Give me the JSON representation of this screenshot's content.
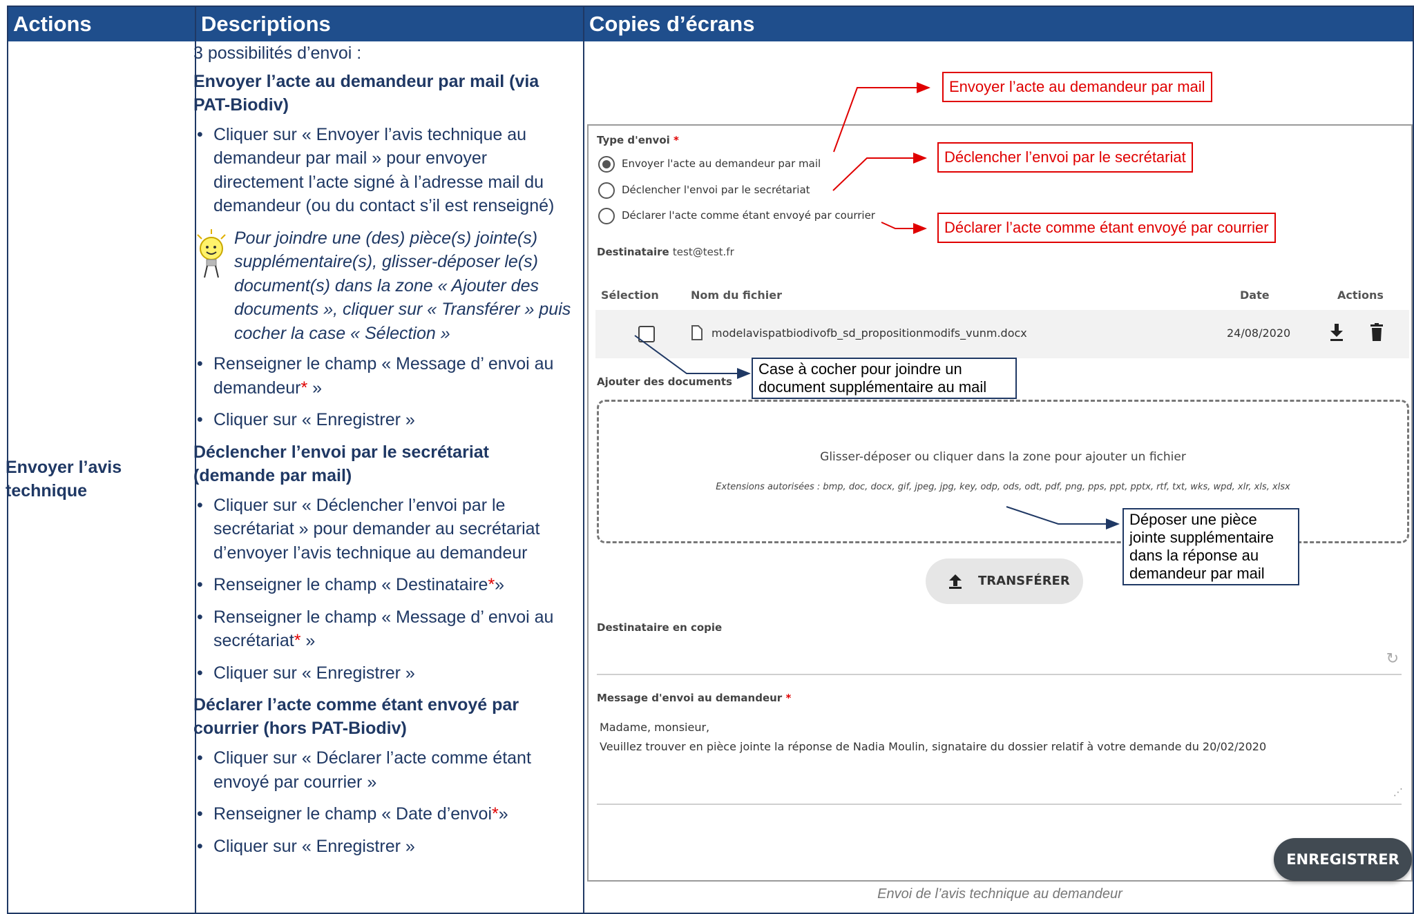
{
  "headers": {
    "actions": "Actions",
    "descriptions": "Descriptions",
    "screenshots": "Copies d’écrans"
  },
  "action_label": "Envoyer l’avis technique",
  "description": {
    "intro": "3 possibilités d’envoi :",
    "section1": {
      "title": "Envoyer l’acte au demandeur par mail (via PAT-Biodiv)",
      "item1": "Cliquer sur « Envoyer l’avis technique au demandeur par mail » pour envoyer directement l’acte signé à l’adresse mail du demandeur (ou du contact s’il est renseigné)",
      "tip": "Pour joindre une (des) pièce(s) jointe(s) supplémentaire(s), glisser-déposer le(s) document(s) dans la zone « Ajouter des documents », cliquer sur « Transférer » puis cocher la case « Sélection »",
      "item2": "Renseigner le champ « Message d’ envoi au demandeur",
      "item2_end": " »",
      "item3": "Cliquer sur « Enregistrer »"
    },
    "section2": {
      "title": "Déclencher l’envoi par le secrétariat (demande par mail)",
      "item1": "Cliquer sur « Déclencher l’envoi par le secrétariat » pour demander au secrétariat d’envoyer l’avis technique au demandeur",
      "item2": "Renseigner le champ « Destinataire",
      "item2_end": "»",
      "item3": "Renseigner le champ « Message d’ envoi au secrétariat",
      "item3_end": " »",
      "item4": "Cliquer sur « Enregistrer »"
    },
    "section3": {
      "title": "Déclarer l’acte comme étant envoyé par courrier (hors PAT-Biodiv)",
      "item1": "Cliquer sur « Déclarer l’acte comme étant envoyé par courrier »",
      "item2": "Renseigner le champ « Date d’envoi",
      "item2_end": "»",
      "item3": "Cliquer sur « Enregistrer »"
    },
    "required_mark": "*"
  },
  "screenshot": {
    "type_label": "Type d'envoi",
    "required_mark": "*",
    "options": [
      "Envoyer l'acte au demandeur par mail",
      "Déclencher l'envoi par le secrétariat",
      "Déclarer l'acte comme étant envoyé par courrier"
    ],
    "selected_option": "Envoyer l'acte au demandeur par mail",
    "recipient_label": "Destinataire",
    "recipient_value": "test@test.fr",
    "table_headers": {
      "selection": "Sélection",
      "filename": "Nom du fichier",
      "date": "Date",
      "actions": "Actions"
    },
    "file": {
      "name": "modelavispatbiodivofb_sd_propositionmodifs_vunm.docx",
      "date": "24/08/2020"
    },
    "add_docs_label": "Ajouter des documents",
    "dropzone_text": "Glisser-déposer ou cliquer dans la zone pour ajouter un fichier",
    "dropzone_ext": "Extensions autorisées : bmp, doc, docx, gif, jpeg, jpg, key, odp, ods, odt, pdf, png, pps, ppt, pptx, rtf, txt, wks, wpd, xlr, xls, xlsx",
    "transfer_label": "TRANSFÉRER",
    "cc_label": "Destinataire en copie",
    "message_label": "Message d'envoi au demandeur",
    "message_text": "Madame, monsieur,\nVeuillez trouver en pièce jointe la réponse de Nadia Moulin, signataire du dossier relatif à votre demande du 20/02/2020",
    "save_label": "ENREGISTRER"
  },
  "callouts": {
    "mail": "Envoyer l’acte au demandeur par mail",
    "secretariat": "Déclencher l’envoi par le secrétariat",
    "courrier": "Déclarer l’acte comme étant envoyé par courrier",
    "checkbox": "Case à cocher pour joindre un document supplémentaire au mail",
    "dropzone": "Déposer une pièce jointe supplémentaire dans la réponse au demandeur par mail"
  },
  "caption": "Envoi de l’avis technique au demandeur",
  "colors": {
    "header_bg": "#1f4e8c",
    "text": "#1f3864",
    "callout_red": "#e00000"
  }
}
